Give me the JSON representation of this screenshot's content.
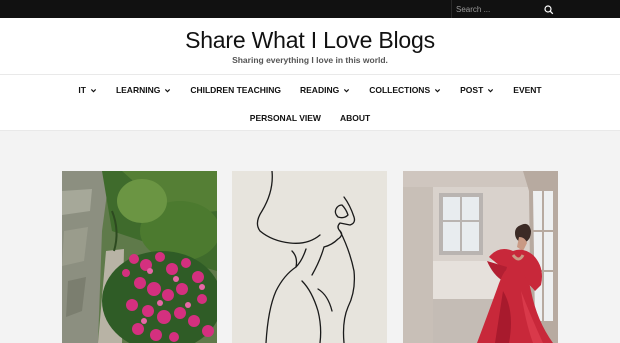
{
  "topbar": {
    "search_placeholder": "Search ...",
    "search_icon": "search-icon"
  },
  "site": {
    "title": "Share What I Love Blogs",
    "tagline": "Sharing everything I love in this world."
  },
  "nav": {
    "row1": [
      {
        "label": "IT",
        "has_dropdown": true
      },
      {
        "label": "LEARNING",
        "has_dropdown": true
      },
      {
        "label": "CHILDREN TEACHING",
        "has_dropdown": false
      },
      {
        "label": "READING",
        "has_dropdown": true
      },
      {
        "label": "COLLECTIONS",
        "has_dropdown": true
      },
      {
        "label": "POST",
        "has_dropdown": true
      },
      {
        "label": "EVENT",
        "has_dropdown": false
      }
    ],
    "row2": [
      {
        "label": "PERSONAL VIEW",
        "has_dropdown": false
      },
      {
        "label": "ABOUT",
        "has_dropdown": false
      }
    ]
  },
  "colors": {
    "topbar": "#111111",
    "content_bg": "#f3f3f3",
    "line_art_bg": "#e7e4dd",
    "dress_red": "#c8283a"
  },
  "posts": [
    {
      "image": "garden-flowers-photo"
    },
    {
      "image": "line-art-portrait"
    },
    {
      "image": "woman-red-dress-photo"
    }
  ]
}
